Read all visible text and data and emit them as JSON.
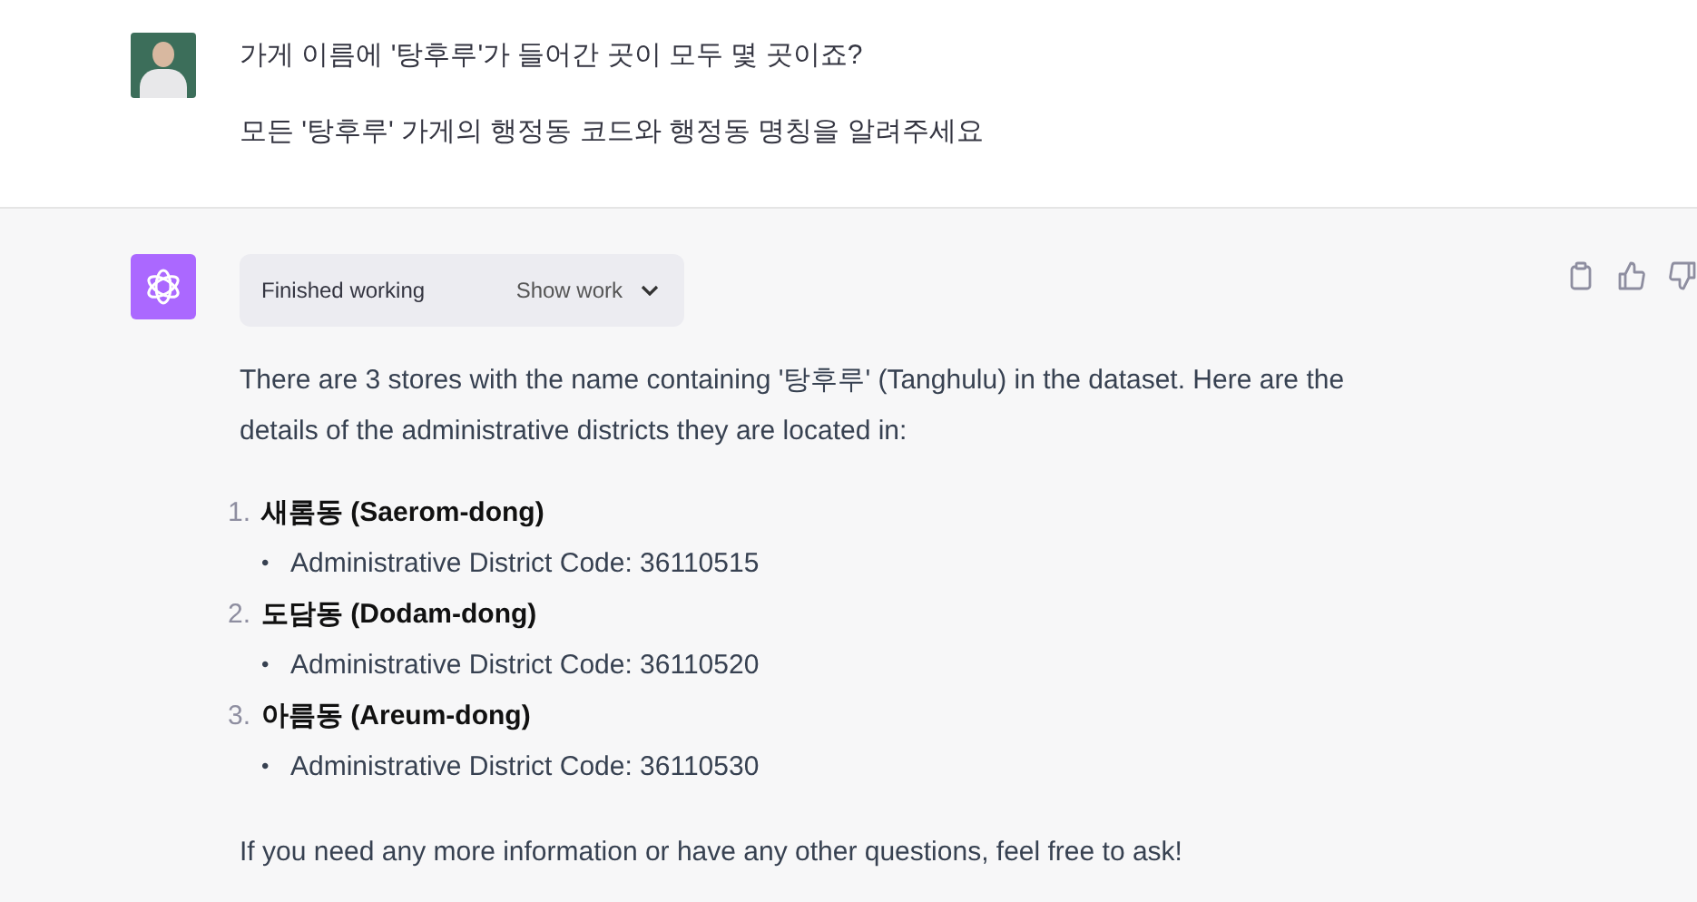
{
  "user_message": {
    "paragraphs": [
      "가게 이름에  '탕후루'가 들어간 곳이 모두 몇 곳이죠?",
      "모든 '탕후루' 가게의 행정동 코드와 행정동 명칭을 알려주세요"
    ]
  },
  "assistant_message": {
    "work_status": {
      "label": "Finished working",
      "toggle": "Show work",
      "expanded": false
    },
    "intro": "There are 3 stores with the name containing '탕후루' (Tanghulu) in the dataset. Here are the details of the administrative districts they are located in:",
    "items": [
      {
        "number": "1.",
        "name": "새롬동 (Saerom-dong)",
        "bullets": [
          {
            "marker": "•",
            "text": "Administrative District Code: 36110515"
          }
        ]
      },
      {
        "number": "2.",
        "name": "도담동 (Dodam-dong)",
        "bullets": [
          {
            "marker": "•",
            "text": "Administrative District Code: 36110520"
          }
        ]
      },
      {
        "number": "3.",
        "name": "아름동 (Areum-dong)",
        "bullets": [
          {
            "marker": "•",
            "text": "Administrative District Code: 36110530"
          }
        ]
      }
    ],
    "outro": "If you need any more information or have any other questions, feel free to ask!"
  }
}
